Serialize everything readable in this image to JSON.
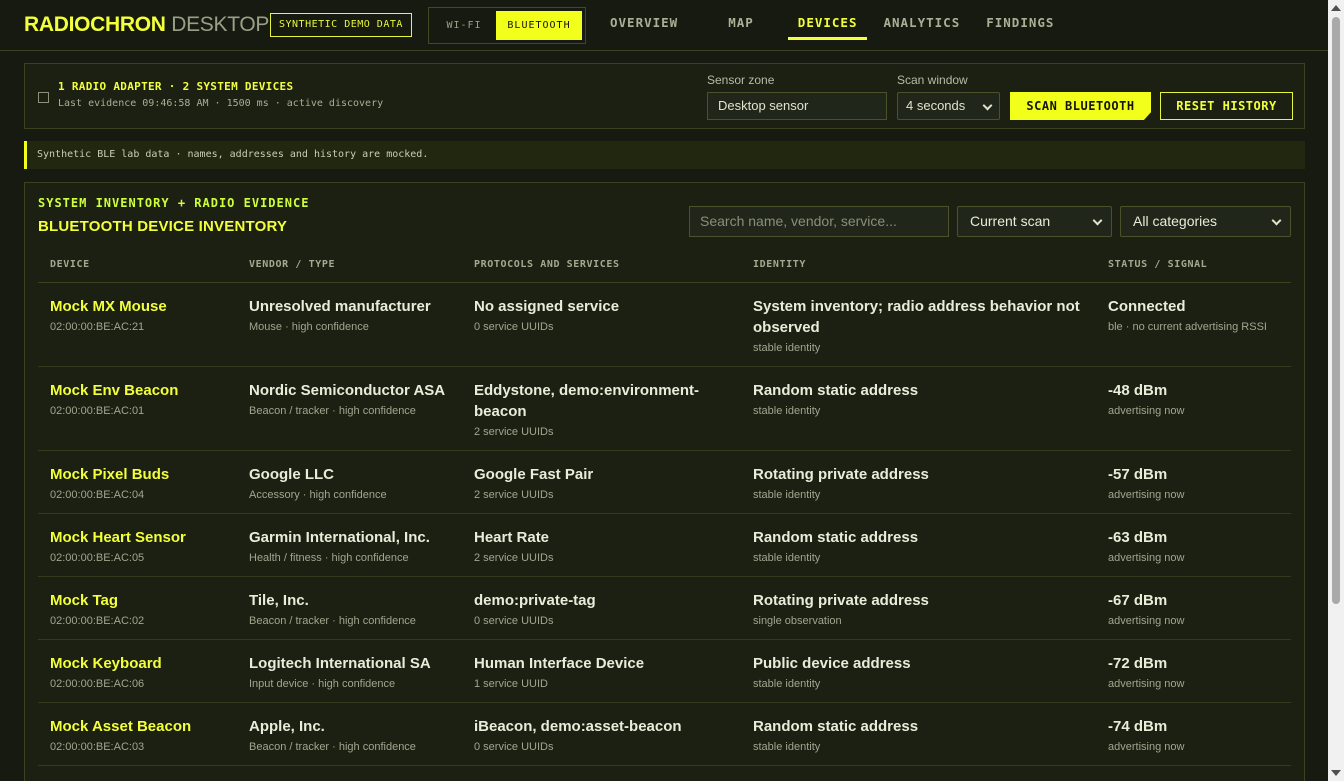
{
  "brand": {
    "part1": "RADIOCHRON",
    "part2": " DESKTOP"
  },
  "demo_badge": "SYNTHETIC DEMO DATA",
  "radio_toggle": {
    "wifi": "WI-FI",
    "bluetooth": "BLUETOOTH",
    "active": "bluetooth"
  },
  "nav": {
    "tabs": [
      "OVERVIEW",
      "MAP",
      "DEVICES",
      "ANALYTICS",
      "FINDINGS"
    ],
    "active": "DEVICES"
  },
  "status": {
    "line1": "1 RADIO ADAPTER · 2 SYSTEM DEVICES",
    "line2": "Last evidence 09:46:58 AM · 1500 ms · active discovery",
    "sensor_zone_label": "Sensor zone",
    "sensor_zone_value": "Desktop sensor",
    "scan_window_label": "Scan window",
    "scan_window_value": "4 seconds",
    "scan_button": "SCAN BLUETOOTH",
    "reset_button": "RESET HISTORY"
  },
  "notice": "Synthetic BLE lab data · names, addresses and history are mocked.",
  "inventory": {
    "kicker": "SYSTEM INVENTORY + RADIO EVIDENCE",
    "title": "BLUETOOTH DEVICE INVENTORY",
    "search_placeholder": "Search name, vendor, service...",
    "scope_select": "Current scan",
    "category_select": "All categories",
    "columns": [
      "DEVICE",
      "VENDOR / TYPE",
      "PROTOCOLS AND SERVICES",
      "IDENTITY",
      "STATUS / SIGNAL"
    ],
    "rows": [
      {
        "name": "Mock MX Mouse",
        "address": "02:00:00:BE:AC:21",
        "vendor": "Unresolved manufacturer",
        "type": "Mouse · high confidence",
        "protocols": "No assigned service",
        "uuids": "0 service UUIDs",
        "identity": "System inventory; radio address behavior not observed",
        "identity_note": "stable identity",
        "status": "Connected",
        "status_note": "ble · no current advertising RSSI"
      },
      {
        "name": "Mock Env Beacon",
        "address": "02:00:00:BE:AC:01",
        "vendor": "Nordic Semiconductor ASA",
        "type": "Beacon / tracker · high confidence",
        "protocols": "Eddystone, demo:environment-beacon",
        "uuids": "2 service UUIDs",
        "identity": "Random static address",
        "identity_note": "stable identity",
        "status": "-48 dBm",
        "status_note": "advertising now"
      },
      {
        "name": "Mock Pixel Buds",
        "address": "02:00:00:BE:AC:04",
        "vendor": "Google LLC",
        "type": "Accessory · high confidence",
        "protocols": "Google Fast Pair",
        "uuids": "2 service UUIDs",
        "identity": "Rotating private address",
        "identity_note": "stable identity",
        "status": "-57 dBm",
        "status_note": "advertising now"
      },
      {
        "name": "Mock Heart Sensor",
        "address": "02:00:00:BE:AC:05",
        "vendor": "Garmin International, Inc.",
        "type": "Health / fitness · high confidence",
        "protocols": "Heart Rate",
        "uuids": "2 service UUIDs",
        "identity": "Random static address",
        "identity_note": "stable identity",
        "status": "-63 dBm",
        "status_note": "advertising now"
      },
      {
        "name": "Mock Tag",
        "address": "02:00:00:BE:AC:02",
        "vendor": "Tile, Inc.",
        "type": "Beacon / tracker · high confidence",
        "protocols": "demo:private-tag",
        "uuids": "0 service UUIDs",
        "identity": "Rotating private address",
        "identity_note": "single observation",
        "status": "-67 dBm",
        "status_note": "advertising now"
      },
      {
        "name": "Mock Keyboard",
        "address": "02:00:00:BE:AC:06",
        "vendor": "Logitech International SA",
        "type": "Input device · high confidence",
        "protocols": "Human Interface Device",
        "uuids": "1 service UUID",
        "identity": "Public device address",
        "identity_note": "stable identity",
        "status": "-72 dBm",
        "status_note": "advertising now"
      },
      {
        "name": "Mock Asset Beacon",
        "address": "02:00:00:BE:AC:03",
        "vendor": "Apple, Inc.",
        "type": "Beacon / tracker · high confidence",
        "protocols": "iBeacon, demo:asset-beacon",
        "uuids": "0 service UUIDs",
        "identity": "Random static address",
        "identity_note": "stable identity",
        "status": "-74 dBm",
        "status_note": "advertising now"
      }
    ]
  },
  "colors": {
    "accent": "#f2ff1a",
    "background": "#161a10",
    "panel": "#1b2013",
    "border": "#3a4220"
  }
}
